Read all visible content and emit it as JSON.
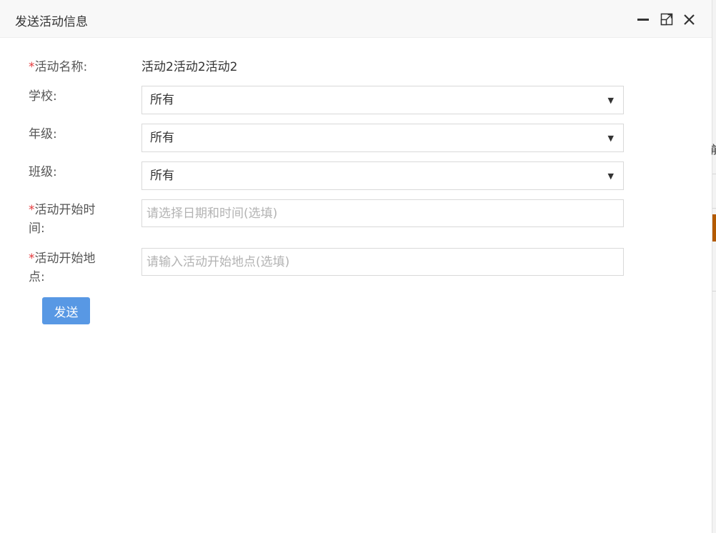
{
  "dialog": {
    "title": "发送活动信息"
  },
  "form": {
    "required_mark": "*",
    "activity_name_label": "活动名称:",
    "activity_name_value": "活动2活动2活动2",
    "school_label": "学校:",
    "school_value": "所有",
    "grade_label": "年级:",
    "grade_value": "所有",
    "class_label": "班级:",
    "class_value": "所有",
    "start_time_label_line1": "活动开始时",
    "start_time_label_line2": "间:",
    "start_time_placeholder": "请选择日期和时间(选填)",
    "start_location_label_line1": "活动开始地",
    "start_location_label_line2": "点:",
    "start_location_placeholder": "请输入活动开始地点(选填)",
    "send_label": "发送"
  },
  "background": {
    "edge_glyph": "前"
  },
  "colors": {
    "required": "#e4393c",
    "primary_button": "#4a90e2",
    "titlebar_bg": "#f8f8f8",
    "border": "#d9d9d9",
    "placeholder": "#b3b3b3"
  },
  "icons": {
    "minimize": "minimize-icon",
    "maximize": "maximize-icon",
    "close": "close-icon",
    "dropdown": "caret-down-icon"
  }
}
